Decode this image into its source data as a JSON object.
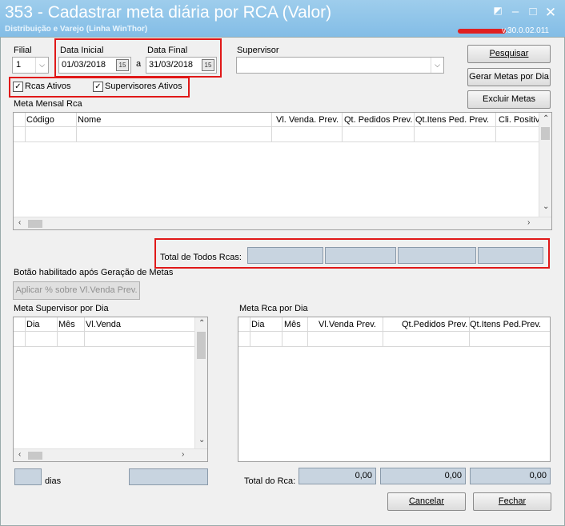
{
  "window": {
    "title": "353 - Cadastrar meta diária por RCA (Valor)",
    "subtitle": "Distribuição e Varejo (Linha WinThor)",
    "version": "v.30.0.02.011"
  },
  "filters": {
    "filial_label": "Filial",
    "filial_value": "1",
    "data_inicial_label": "Data Inicial",
    "data_inicial_value": "01/03/2018",
    "a_label": "a",
    "data_final_label": "Data Final",
    "data_final_value": "31/03/2018",
    "supervisor_label": "Supervisor",
    "supervisor_value": ""
  },
  "checks": {
    "rcas_ativos": "Rcas Ativos",
    "supervisores_ativos": "Supervisores Ativos"
  },
  "buttons": {
    "pesquisar": "Pesquisar",
    "gerar": "Gerar Metas por Dia",
    "excluir": "Excluir Metas",
    "aplicar": "Aplicar % sobre Vl.Venda Prev.",
    "cancelar": "Cancelar",
    "fechar": "Fechar"
  },
  "meta_mensal": {
    "title": "Meta Mensal Rca",
    "columns": [
      "Código",
      "Nome",
      "Vl. Venda. Prev.",
      "Qt. Pedidos Prev.",
      "Qt.Itens Ped. Prev.",
      "Cli. Positiv"
    ]
  },
  "totais": {
    "label": "Total de Todos Rcas:",
    "values": [
      "",
      "",
      "",
      "",
      ""
    ]
  },
  "botao_info": "Botão habilitado após Geração de Metas",
  "meta_sup": {
    "title": "Meta Supervisor por Dia",
    "columns": [
      "Dia",
      "Mês",
      "Vl.Venda"
    ]
  },
  "meta_rca": {
    "title": "Meta Rca por Dia",
    "columns": [
      "Dia",
      "Mês",
      "Vl.Venda Prev.",
      "Qt.Pedidos Prev.",
      "Qt.Itens Ped.Prev."
    ]
  },
  "dias_label": "dias",
  "total_rca": {
    "label": "Total do Rca:",
    "values": [
      "0,00",
      "0,00",
      "0,00"
    ]
  }
}
